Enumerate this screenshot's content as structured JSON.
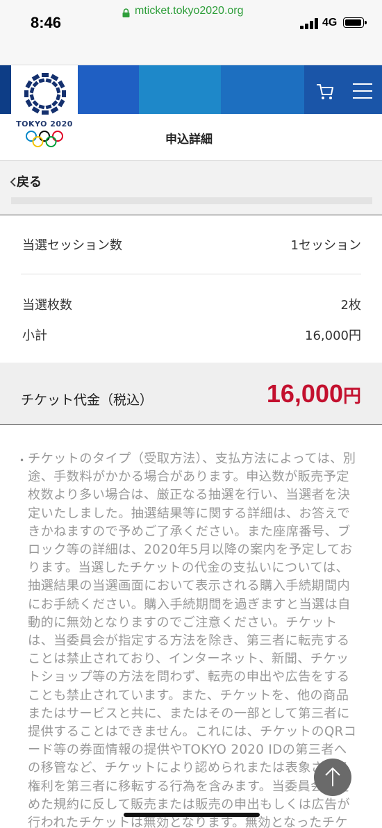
{
  "status_bar": {
    "time": "8:46",
    "network": "4G"
  },
  "browser": {
    "url": "mticket.tokyo2020.org"
  },
  "header": {
    "logo_text": "TOKYO 2020"
  },
  "page": {
    "title": "申込詳細",
    "back_label": "戻る"
  },
  "summary": {
    "rows": [
      {
        "label": "当選セッション数",
        "value": "1セッション"
      },
      {
        "label": "当選枚数",
        "value": "2枚"
      },
      {
        "label": "小計",
        "value": "16,000円"
      }
    ],
    "total_label": "チケット代金（税込）",
    "total_amount": "16,000",
    "total_unit": "円"
  },
  "notice": {
    "bullet": "•",
    "text": "チケットのタイプ（受取方法）、支払方法によっては、別途、手数料がかかる場合があります。申込数が販売予定枚数より多い場合は、厳正なる抽選を行い、当選者を決定いたしました。抽選結果等に関する詳細は、お答えできかねますので予めご了承ください。また座席番号、ブロック等の詳細は、2020年5月以降の案内を予定しております。当選したチケットの代金の支払いについては、抽選結果の当選画面において表示される購入手続期間内にお手続ください。購入手続期間を過ぎますと当選は自動的に無効となりますのでご注意ください。チケットは、当委員会が指定する方法を除き、第三者に転売することは禁止されており、インターネット、新聞、チケットショップ等の方法を問わず、転売の申出や広告をすることも禁止されています。また、チケットを、他の商品またはサービスと共に、またはその一部として第三者に提供することはできません。これには、チケットのQRコード等の券面情報の提供やTOKYO 2020 IDの第三者への移管など、チケットにより認められまたは表象される権利を第三者に移転する行為を含みます。当委員会が定めた規約に反して販売または販売の申出もしくは広告が行われたチケットは無効となります。無効となったチケット"
  },
  "colors": {
    "brand_blue": "#0a3b8c",
    "accent_red": "#c3102e",
    "url_green": "#2e9e3a"
  },
  "icons": [
    "lock-icon",
    "cart-icon",
    "menu-icon",
    "chevron-left-icon",
    "arrow-up-icon"
  ]
}
